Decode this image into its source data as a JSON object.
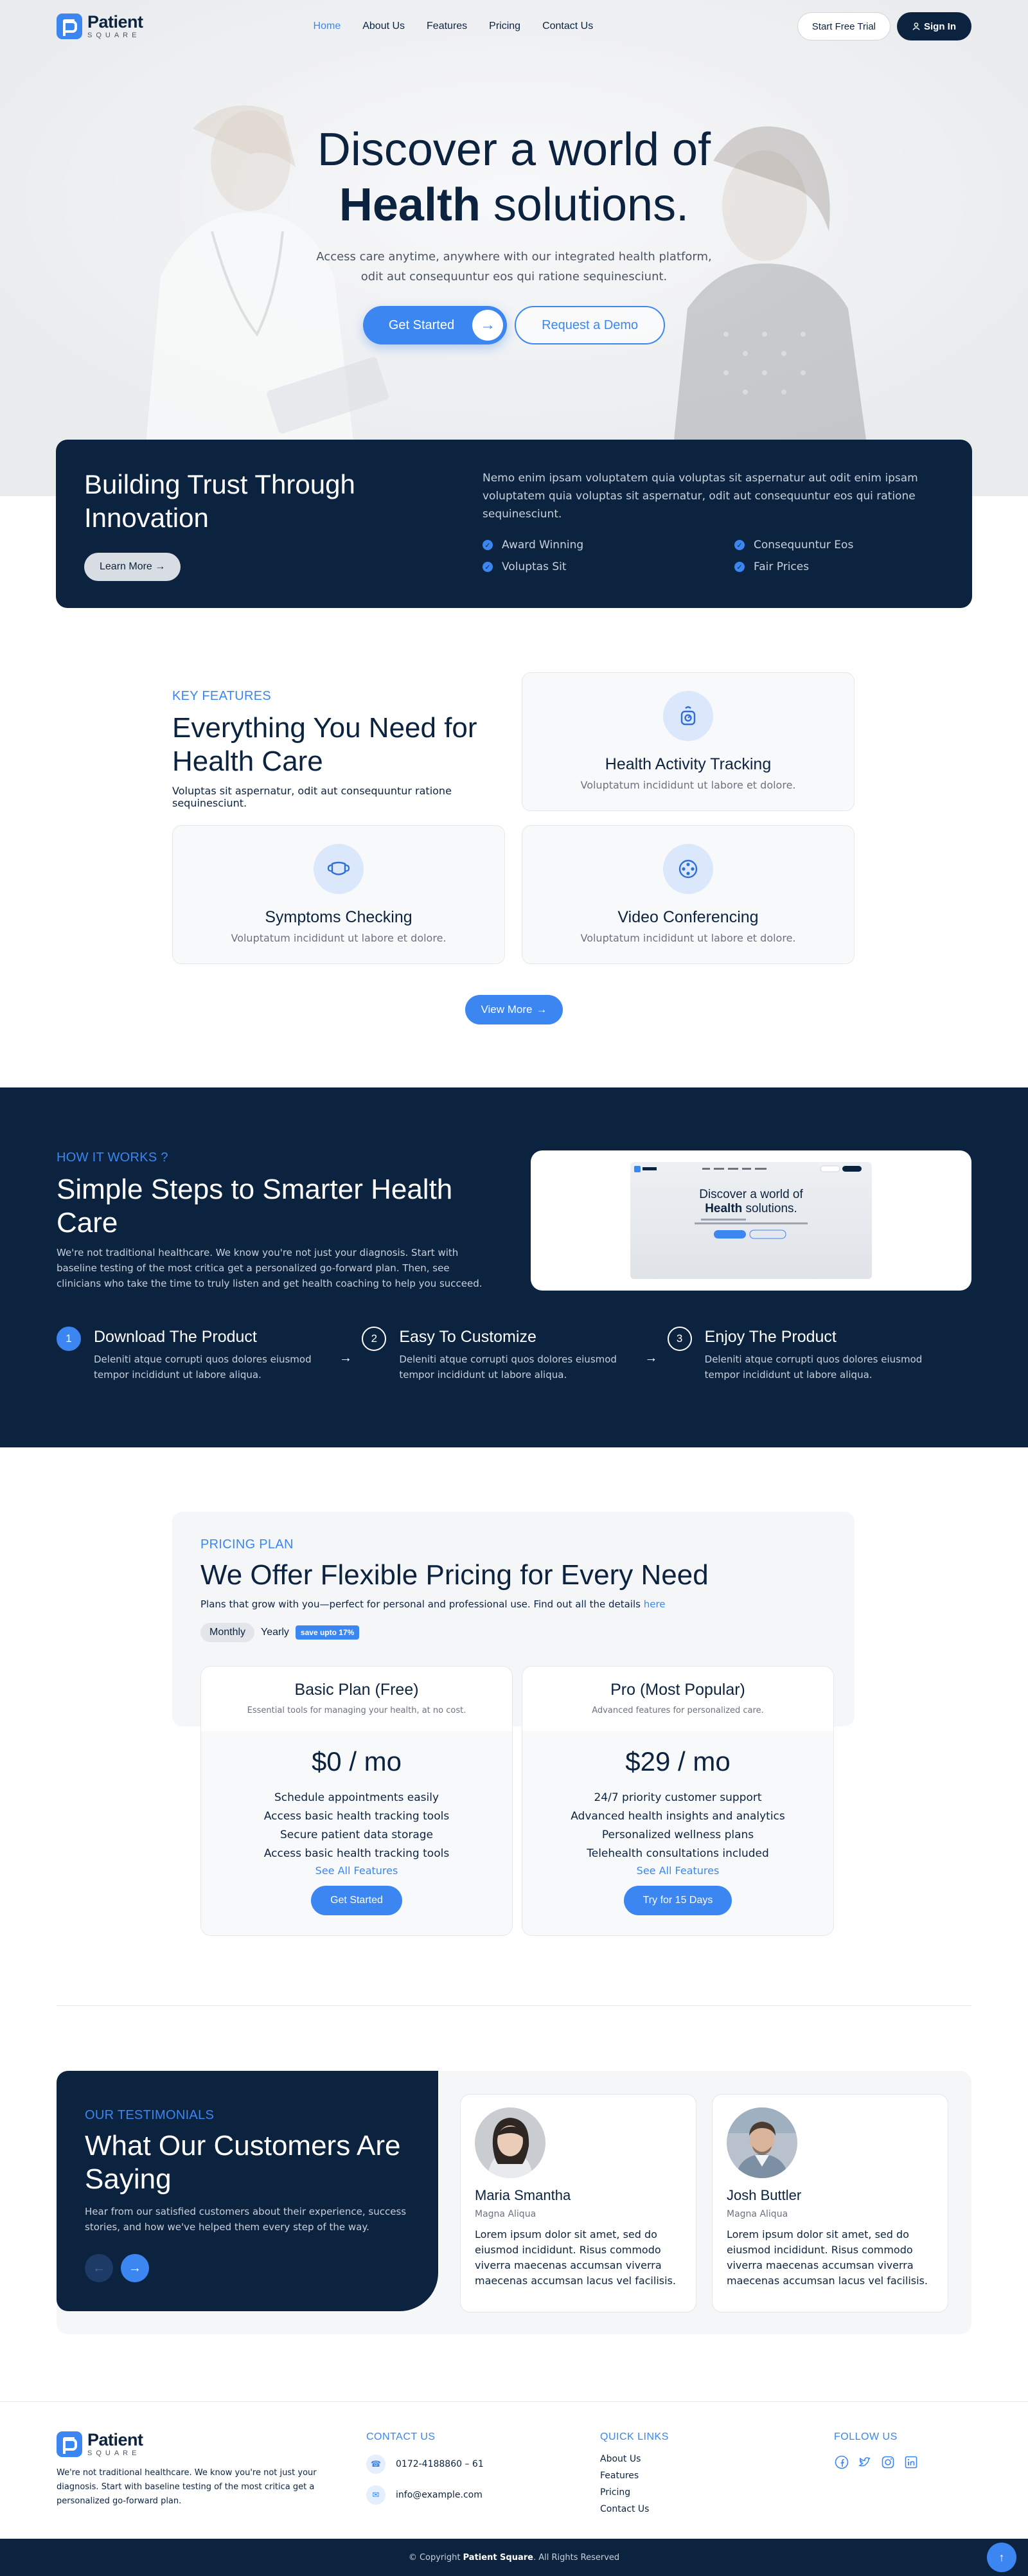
{
  "brand": {
    "name": "Patient",
    "sub": "SQUARE"
  },
  "nav": {
    "items": [
      {
        "label": "Home",
        "active": true
      },
      {
        "label": "About Us"
      },
      {
        "label": "Features"
      },
      {
        "label": "Pricing"
      },
      {
        "label": "Contact Us"
      }
    ],
    "trial_label": "Start Free Trial",
    "signin_label": "Sign In"
  },
  "hero": {
    "title_line1": "Discover a world of",
    "title_bold": "Health",
    "title_rest": " solutions.",
    "subtitle_line1": "Access care anytime, anywhere with our integrated health platform,",
    "subtitle_line2": "odit aut consequuntur eos qui ratione sequinesciunt.",
    "start_label": "Get Started",
    "demo_label": "Request a Demo"
  },
  "trust": {
    "title": "Building Trust Through Innovation",
    "learn_label": "Learn More",
    "text": "Nemo enim ipsam voluptatem quia voluptas sit aspernatur aut odit enim ipsam voluptatem quia voluptas sit aspernatur, odit aut consequuntur eos qui ratione sequinesciunt.",
    "list": [
      "Award Winning",
      "Consequuntur Eos",
      "Voluptas Sit",
      "Fair Prices"
    ]
  },
  "features": {
    "eyebrow": "KEY FEATURES",
    "title": "Everything You Need for Health Care",
    "subtitle": "Voluptas sit aspernatur, odit aut consequuntur ratione sequinesciunt.",
    "cards": [
      {
        "title": "Health Activity Tracking",
        "text": "Voluptatum incididunt ut labore et dolore.",
        "icon": "scale-icon"
      },
      {
        "title": "Symptoms Checking",
        "text": "Voluptatum incididunt ut labore et dolore.",
        "icon": "mask-icon"
      },
      {
        "title": "Video Conferencing",
        "text": "Voluptatum incididunt ut labore et dolore.",
        "icon": "film-reel-icon"
      }
    ],
    "view_more_label": "View More"
  },
  "how": {
    "eyebrow": "HOW IT WORKS ?",
    "title": "Simple Steps to Smarter Health Care",
    "text": "We're not traditional healthcare. We know you're not just your diagnosis. Start with baseline testing of the most critica get a personalized go-forward plan. Then, see clinicians who take the time to truly listen and get health coaching to help you succeed.",
    "preview_line1": "Discover a world of",
    "preview_bold": "Health",
    "preview_rest": " solutions.",
    "steps": [
      {
        "num": "1",
        "title": "Download The Product",
        "text": "Deleniti atque corrupti quos dolores eiusmod tempor incididunt ut labore aliqua."
      },
      {
        "num": "2",
        "title": "Easy To Customize",
        "text": "Deleniti atque corrupti quos dolores eiusmod tempor incididunt ut labore aliqua."
      },
      {
        "num": "3",
        "title": "Enjoy The Product",
        "text": "Deleniti atque corrupti quos dolores eiusmod tempor incididunt ut labore aliqua."
      }
    ]
  },
  "pricing": {
    "eyebrow": "PRICING PLAN",
    "title": "We Offer Flexible Pricing for Every Need",
    "subtitle": "Plans that grow with you—perfect for personal and professional use. Find out all the details ",
    "subtitle_link": "here",
    "toggle_monthly": "Monthly",
    "toggle_yearly": "Yearly",
    "save_badge": "save upto 17%",
    "plans": [
      {
        "name": "Basic Plan (Free)",
        "desc": "Essential tools for managing your health, at no cost.",
        "price": "$0",
        "period": " / mo",
        "features": [
          "Schedule appointments easily",
          "Access basic health tracking tools",
          "Secure patient data storage",
          "Access basic health tracking tools"
        ],
        "see_all": "See All Features",
        "cta": "Get Started"
      },
      {
        "name": "Pro (Most Popular)",
        "desc": "Advanced features for personalized care.",
        "price": "$29",
        "period": " / mo",
        "features": [
          "24/7 priority customer support",
          "Advanced health insights and analytics",
          "Personalized wellness plans",
          "Telehealth consultations included"
        ],
        "see_all": "See All Features",
        "cta": "Try for 15 Days"
      }
    ]
  },
  "testimonials": {
    "eyebrow": "OUR TESTIMONIALS",
    "title": "What Our Customers Are Saying",
    "text": "Hear from our satisfied customers about their experience, success stories, and how we've helped them every step of the way.",
    "items": [
      {
        "name": "Maria Smantha",
        "role": "Magna Aliqua",
        "quote": "Lorem ipsum dolor sit amet, sed do eiusmod incididunt. Risus commodo viverra maecenas accumsan viverra maecenas accumsan lacus vel facilisis."
      },
      {
        "name": "Josh Buttler",
        "role": "Magna Aliqua",
        "quote": "Lorem ipsum dolor sit amet, sed do eiusmod incididunt. Risus commodo viverra maecenas accumsan viverra maecenas accumsan lacus vel facilisis."
      }
    ]
  },
  "footer": {
    "desc": "We're not traditional healthcare. We know you're not just your diagnosis. Start with baseline testing of the most critica get a personalized go-forward plan.",
    "contact_title": "CONTACT US",
    "phone": "0172-4188860 – 61",
    "email": "info@example.com",
    "links_title": "QUICK LINKS",
    "links": [
      "About Us",
      "Features",
      "Pricing",
      "Contact Us"
    ],
    "follow_title": "FOLLOW US",
    "social": [
      "facebook-icon",
      "twitter-icon",
      "instagram-icon",
      "linkedin-icon"
    ],
    "copy_prefix": "© Copyright ",
    "copy_brand": "Patient Square",
    "copy_suffix": ". All Rights Reserved"
  },
  "colors": {
    "navy": "#0c2340",
    "accent": "#3b86f0"
  }
}
